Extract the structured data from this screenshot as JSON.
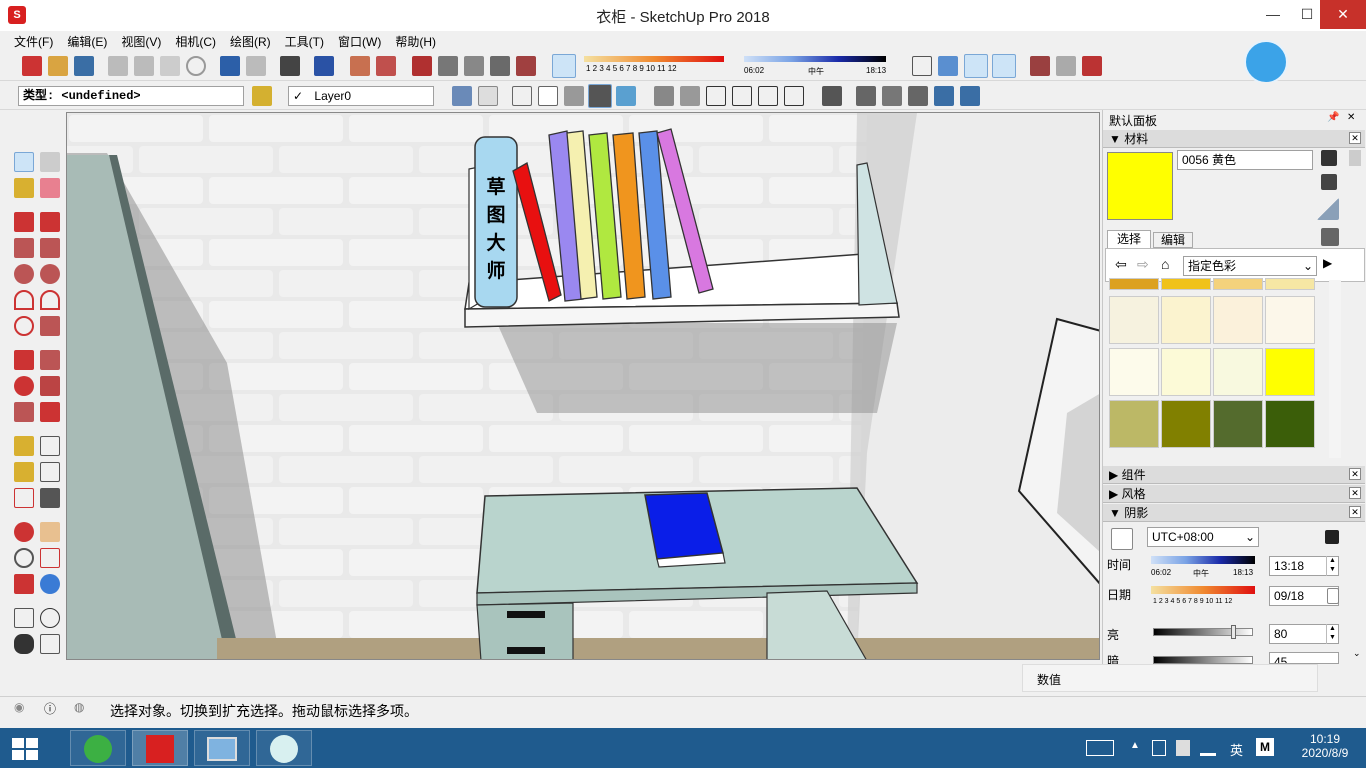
{
  "window": {
    "title": "衣柜 - SketchUp Pro 2018",
    "minimize": "—",
    "maximize": "☐",
    "close": "✕"
  },
  "menu": [
    "文件(F)",
    "编辑(E)",
    "视图(V)",
    "相机(C)",
    "绘图(R)",
    "工具(T)",
    "窗口(W)",
    "帮助(H)"
  ],
  "toolbar": {
    "shadow_hours": "1 2 3 4 5 6 7 8 9 10 11 12",
    "time_start": "06:02",
    "time_mid": "中午",
    "time_end": "18:13"
  },
  "entity": {
    "type_label": "类型:",
    "type_value": "<undefined>",
    "layer_check": "✓",
    "layer_value": "Layer0"
  },
  "scene": {
    "book_spine_text": "草图大师"
  },
  "tray": {
    "title": "默认面板",
    "materials": {
      "section": "材料",
      "name": "0056 黄色",
      "tab_select": "选择",
      "tab_edit": "编辑",
      "category": "指定色彩",
      "swatches": [
        "#dca11f",
        "#f0c219",
        "#f4d27c",
        "#f6e7a4",
        "#f6f2df",
        "#fbf3cf",
        "#fbf1db",
        "#fcf7ea",
        "#fdfbeb",
        "#fcfad7",
        "#f8f9df",
        "#ffff00",
        "#bcb866",
        "#818000",
        "#546b2d",
        "#3b5e09"
      ],
      "selected_color": "#ffff00"
    },
    "components": "组件",
    "styles": "风格",
    "shadows": {
      "section": "阴影",
      "utc": "UTC+08:00",
      "time_label": "时间",
      "time_start": "06:02",
      "time_mid": "中午",
      "time_end": "18:13",
      "time_value": "13:18",
      "date_label": "日期",
      "date_months": "1 2 3 4 5 6 7 8 9 10 11 12",
      "date_value": "09/18",
      "light_label": "亮",
      "light_value": "80",
      "light_level": 0.8,
      "dark_label": "暗",
      "dark_value": "45"
    }
  },
  "measurements": {
    "label": "数值"
  },
  "status": {
    "message": "选择对象。切换到扩充选择。拖动鼠标选择多项。"
  },
  "taskbar": {
    "lang": "英",
    "ime": "M",
    "time": "10:19",
    "date": "2020/8/9"
  }
}
